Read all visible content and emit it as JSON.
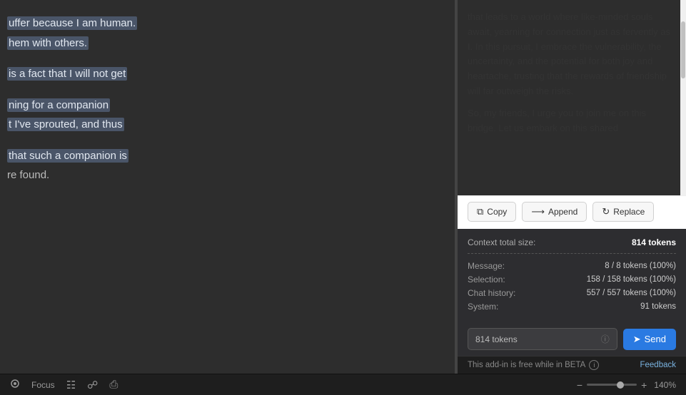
{
  "editor": {
    "blocks": [
      {
        "lines": [
          {
            "text": "uffer because I am human.",
            "highlighted": true
          },
          {
            "text": "hem with others.",
            "highlighted": true
          }
        ]
      },
      {
        "lines": [
          {
            "text": "is a fact that I will not get",
            "highlighted": true
          }
        ]
      },
      {
        "lines": [
          {
            "text": "ning for a companion",
            "highlighted": true
          },
          {
            "text": "t I've sprouted, and thus",
            "highlighted": true
          }
        ]
      },
      {
        "lines": [
          {
            "text": "that such a companion is",
            "highlighted": true
          },
          {
            "text": "re found.",
            "highlighted": false
          }
        ]
      }
    ]
  },
  "sidebar": {
    "ai_response": "that leads to a world where like-minded souls await, yearning for connection just as fervently as I. In this pursuit, I embrace the vulnerability, the uncertainty, and the potential for both joy and heartache, trusting that the rewards of friendship will far outweigh the risks.",
    "ai_response2": "So, my friends, I urge you to join me on this bridge. Let us embark on this shared",
    "buttons": {
      "copy": "Copy",
      "append": "Append",
      "replace": "Replace"
    },
    "token_stats": {
      "title": "Context total size:",
      "total": "814 tokens",
      "rows": [
        {
          "label": "Message:",
          "value": "8 / 8 tokens (100%)"
        },
        {
          "label": "Selection:",
          "value": "158 / 158 tokens (100%)"
        },
        {
          "label": "Chat history:",
          "value": "557 / 557 tokens (100%)"
        },
        {
          "label": "System:",
          "value": "91 tokens"
        }
      ]
    },
    "send_area": {
      "token_display": "814 tokens",
      "send_label": "Send"
    },
    "beta_notice": "This add-in is free while in BETA",
    "feedback_label": "Feedback"
  },
  "statusbar": {
    "focus_label": "Focus",
    "zoom_level": "140%",
    "icons": [
      "document-layout-icon",
      "document-icon",
      "print-icon"
    ]
  }
}
